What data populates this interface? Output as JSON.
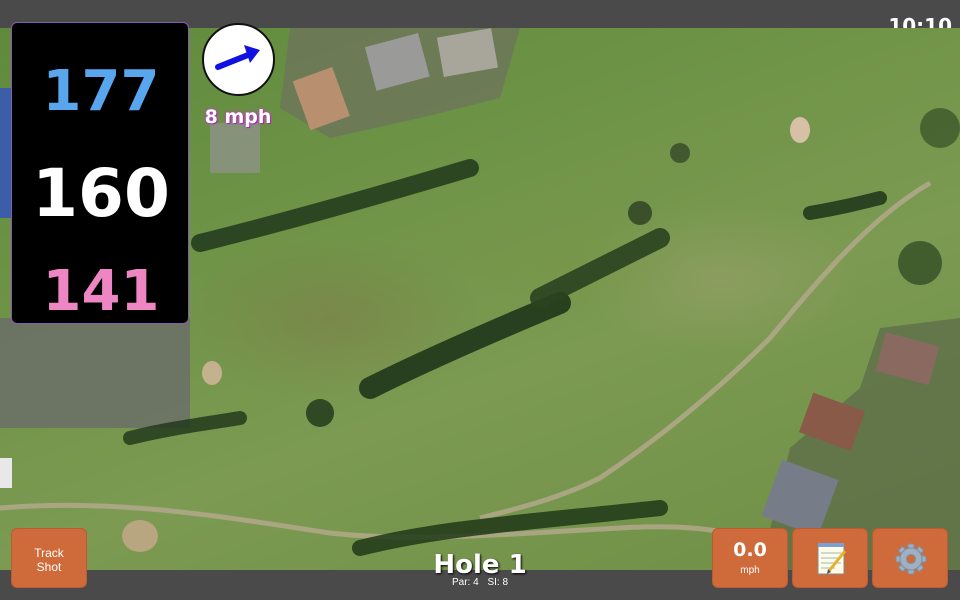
{
  "status_bar": {
    "time": "10:10"
  },
  "distances": {
    "back": "177",
    "middle": "160",
    "front": "141"
  },
  "wind": {
    "speed_label": "8 mph",
    "direction_icon": "arrow-right-icon"
  },
  "hole": {
    "title": "Hole 1",
    "par": "Par: 4",
    "stroke_index": "SI: 8"
  },
  "controls": {
    "track_shot_line1": "Track",
    "track_shot_line2": "Shot",
    "wind_value": "0.0",
    "wind_unit": "mph",
    "notes_icon": "notepad-icon",
    "settings_icon": "gear-icon"
  },
  "colors": {
    "back_distance": "#5aa6ee",
    "middle_distance": "#ffffff",
    "front_distance": "#ee86c4",
    "button": "#cf6b3a"
  }
}
